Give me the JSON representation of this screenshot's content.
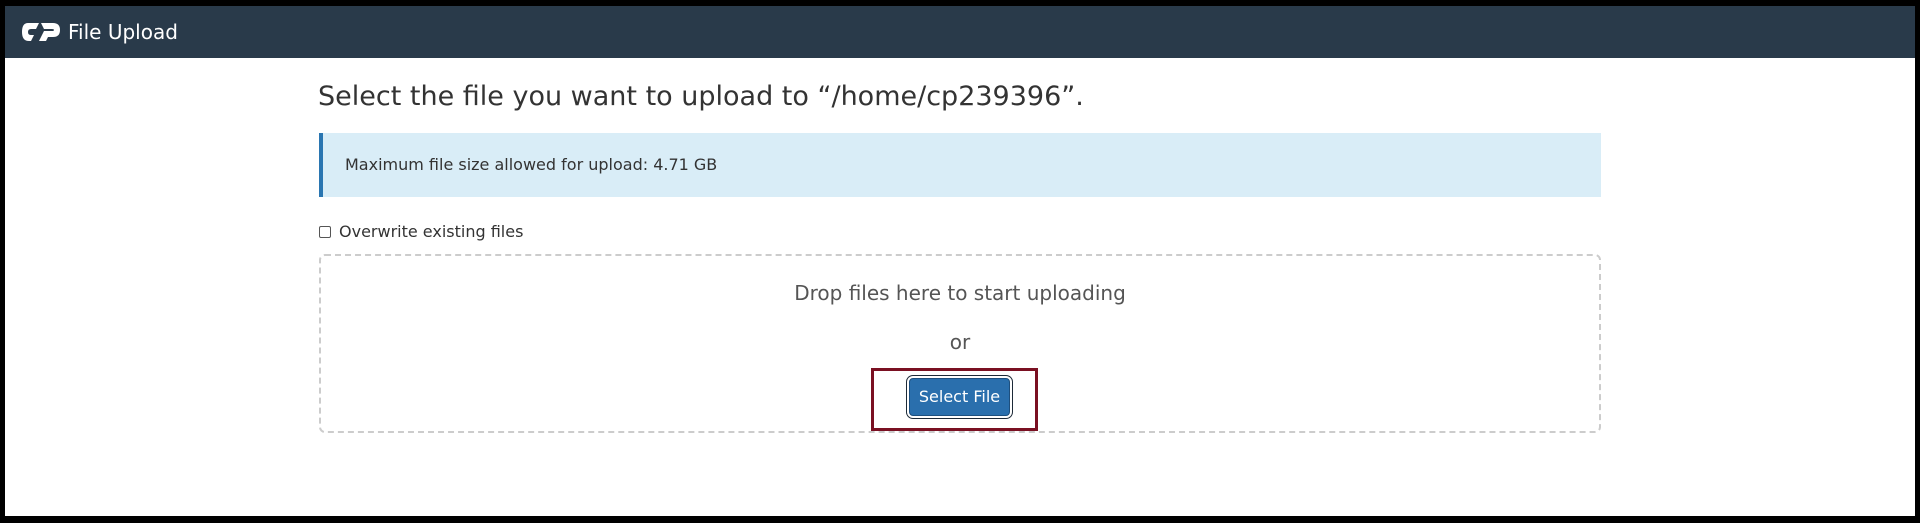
{
  "header": {
    "logo_icon": "cpanel-logo-icon",
    "title": "File Upload",
    "background_color": "#293a4a"
  },
  "main": {
    "page_title": "Select the file you want to upload to “/home/cp239396”.",
    "alert": {
      "text": "Maximum file size allowed for upload: 4.71 GB",
      "background_color": "#d9edf7",
      "accent_color": "#2a76b1"
    },
    "overwrite": {
      "label": "Overwrite existing files",
      "checked": false
    },
    "dropzone": {
      "drop_text": "Drop files here to start uploading",
      "or_text": "or",
      "select_button_label": "Select File",
      "button_color": "#2a6fad"
    },
    "highlight_color": "#7a1022"
  }
}
